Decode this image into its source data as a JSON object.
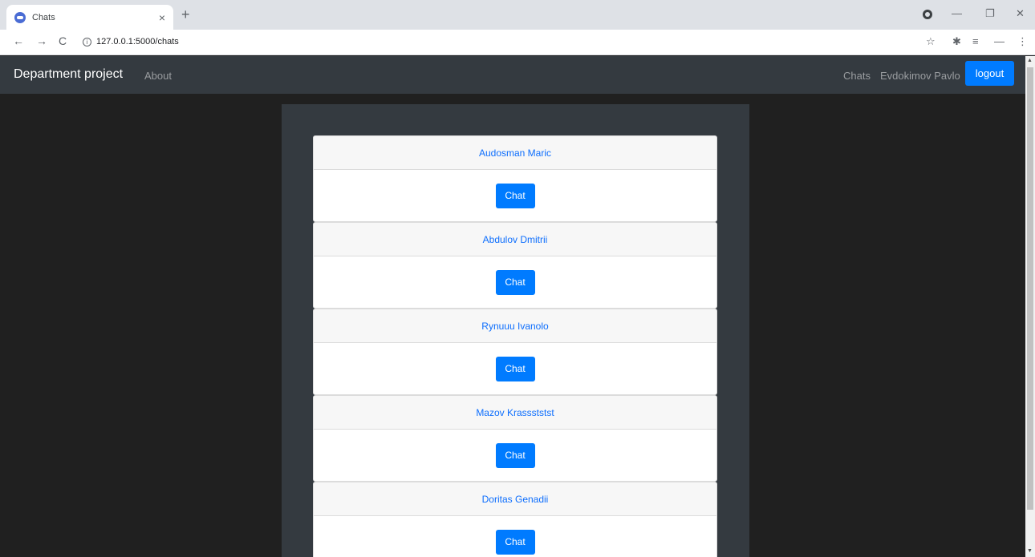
{
  "browser": {
    "tab_title": "Chats",
    "tab_close": "×",
    "new_tab": "+",
    "url": "127.0.0.1:5000/chats",
    "back": "←",
    "forward": "→",
    "reload": "C",
    "info": "i",
    "star": "☆",
    "extensions": "✱",
    "reading_list": "≡",
    "minimize_bar": "—",
    "menu": "⋮",
    "win_minimize": "—",
    "win_restore": "❐",
    "win_close": "✕"
  },
  "navbar": {
    "brand": "Department project",
    "about": "About",
    "chats": "Chats",
    "user": "Evdokimov Pavlo",
    "logout": "logout"
  },
  "chats": [
    {
      "name": "Audosman Maric",
      "button": "Chat"
    },
    {
      "name": "Abdulov Dmitrii",
      "button": "Chat"
    },
    {
      "name": "Rynuuu Ivanolo",
      "button": "Chat"
    },
    {
      "name": "Mazov Krassststst",
      "button": "Chat"
    },
    {
      "name": "Doritas Genadii",
      "button": "Chat"
    }
  ],
  "colors": {
    "navbar_bg": "#343a40",
    "page_bg": "#202020",
    "accent": "#007bff",
    "link": "#0d6efd"
  }
}
